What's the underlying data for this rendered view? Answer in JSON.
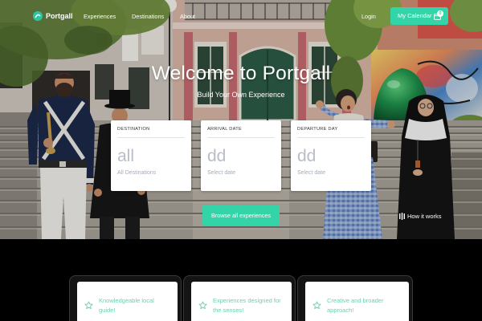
{
  "brand": {
    "name": "Portgall",
    "logo_icon": "portgall-logo-icon"
  },
  "nav": {
    "items": [
      {
        "label": "Experiences"
      },
      {
        "label": "Destinations"
      },
      {
        "label": "About"
      }
    ]
  },
  "account": {
    "login_label": "Login",
    "calendar_label": "My Calendar",
    "calendar_count": "0",
    "calendar_icon": "calendar-icon"
  },
  "hero": {
    "title": "Welcome to Portgall",
    "subtitle": "Build Your Own Experience"
  },
  "search_cards": [
    {
      "label": "DESTINATION",
      "value": "all",
      "hint": "All Destinations"
    },
    {
      "label": "ARRIVAL DATE",
      "value": "dd",
      "hint": "Select date"
    },
    {
      "label": "DEPARTURE DAY",
      "value": "dd",
      "hint": "Select date"
    }
  ],
  "actions": {
    "browse_label": "Browse all experiences",
    "how_label": "How it works",
    "how_icon": "video-icon"
  },
  "features": [
    {
      "text": "Knowledgeable local guide!",
      "icon": "star-icon"
    },
    {
      "text": "Experiences designed for the senses!",
      "icon": "star-icon"
    },
    {
      "text": "Creative and broader approach!",
      "icon": "star-icon"
    }
  ],
  "colors": {
    "accent": "#33d4a8",
    "feature_text": "#6ecfb3",
    "card_value": "#b8bdc7",
    "card_hint": "#a6acb6"
  }
}
